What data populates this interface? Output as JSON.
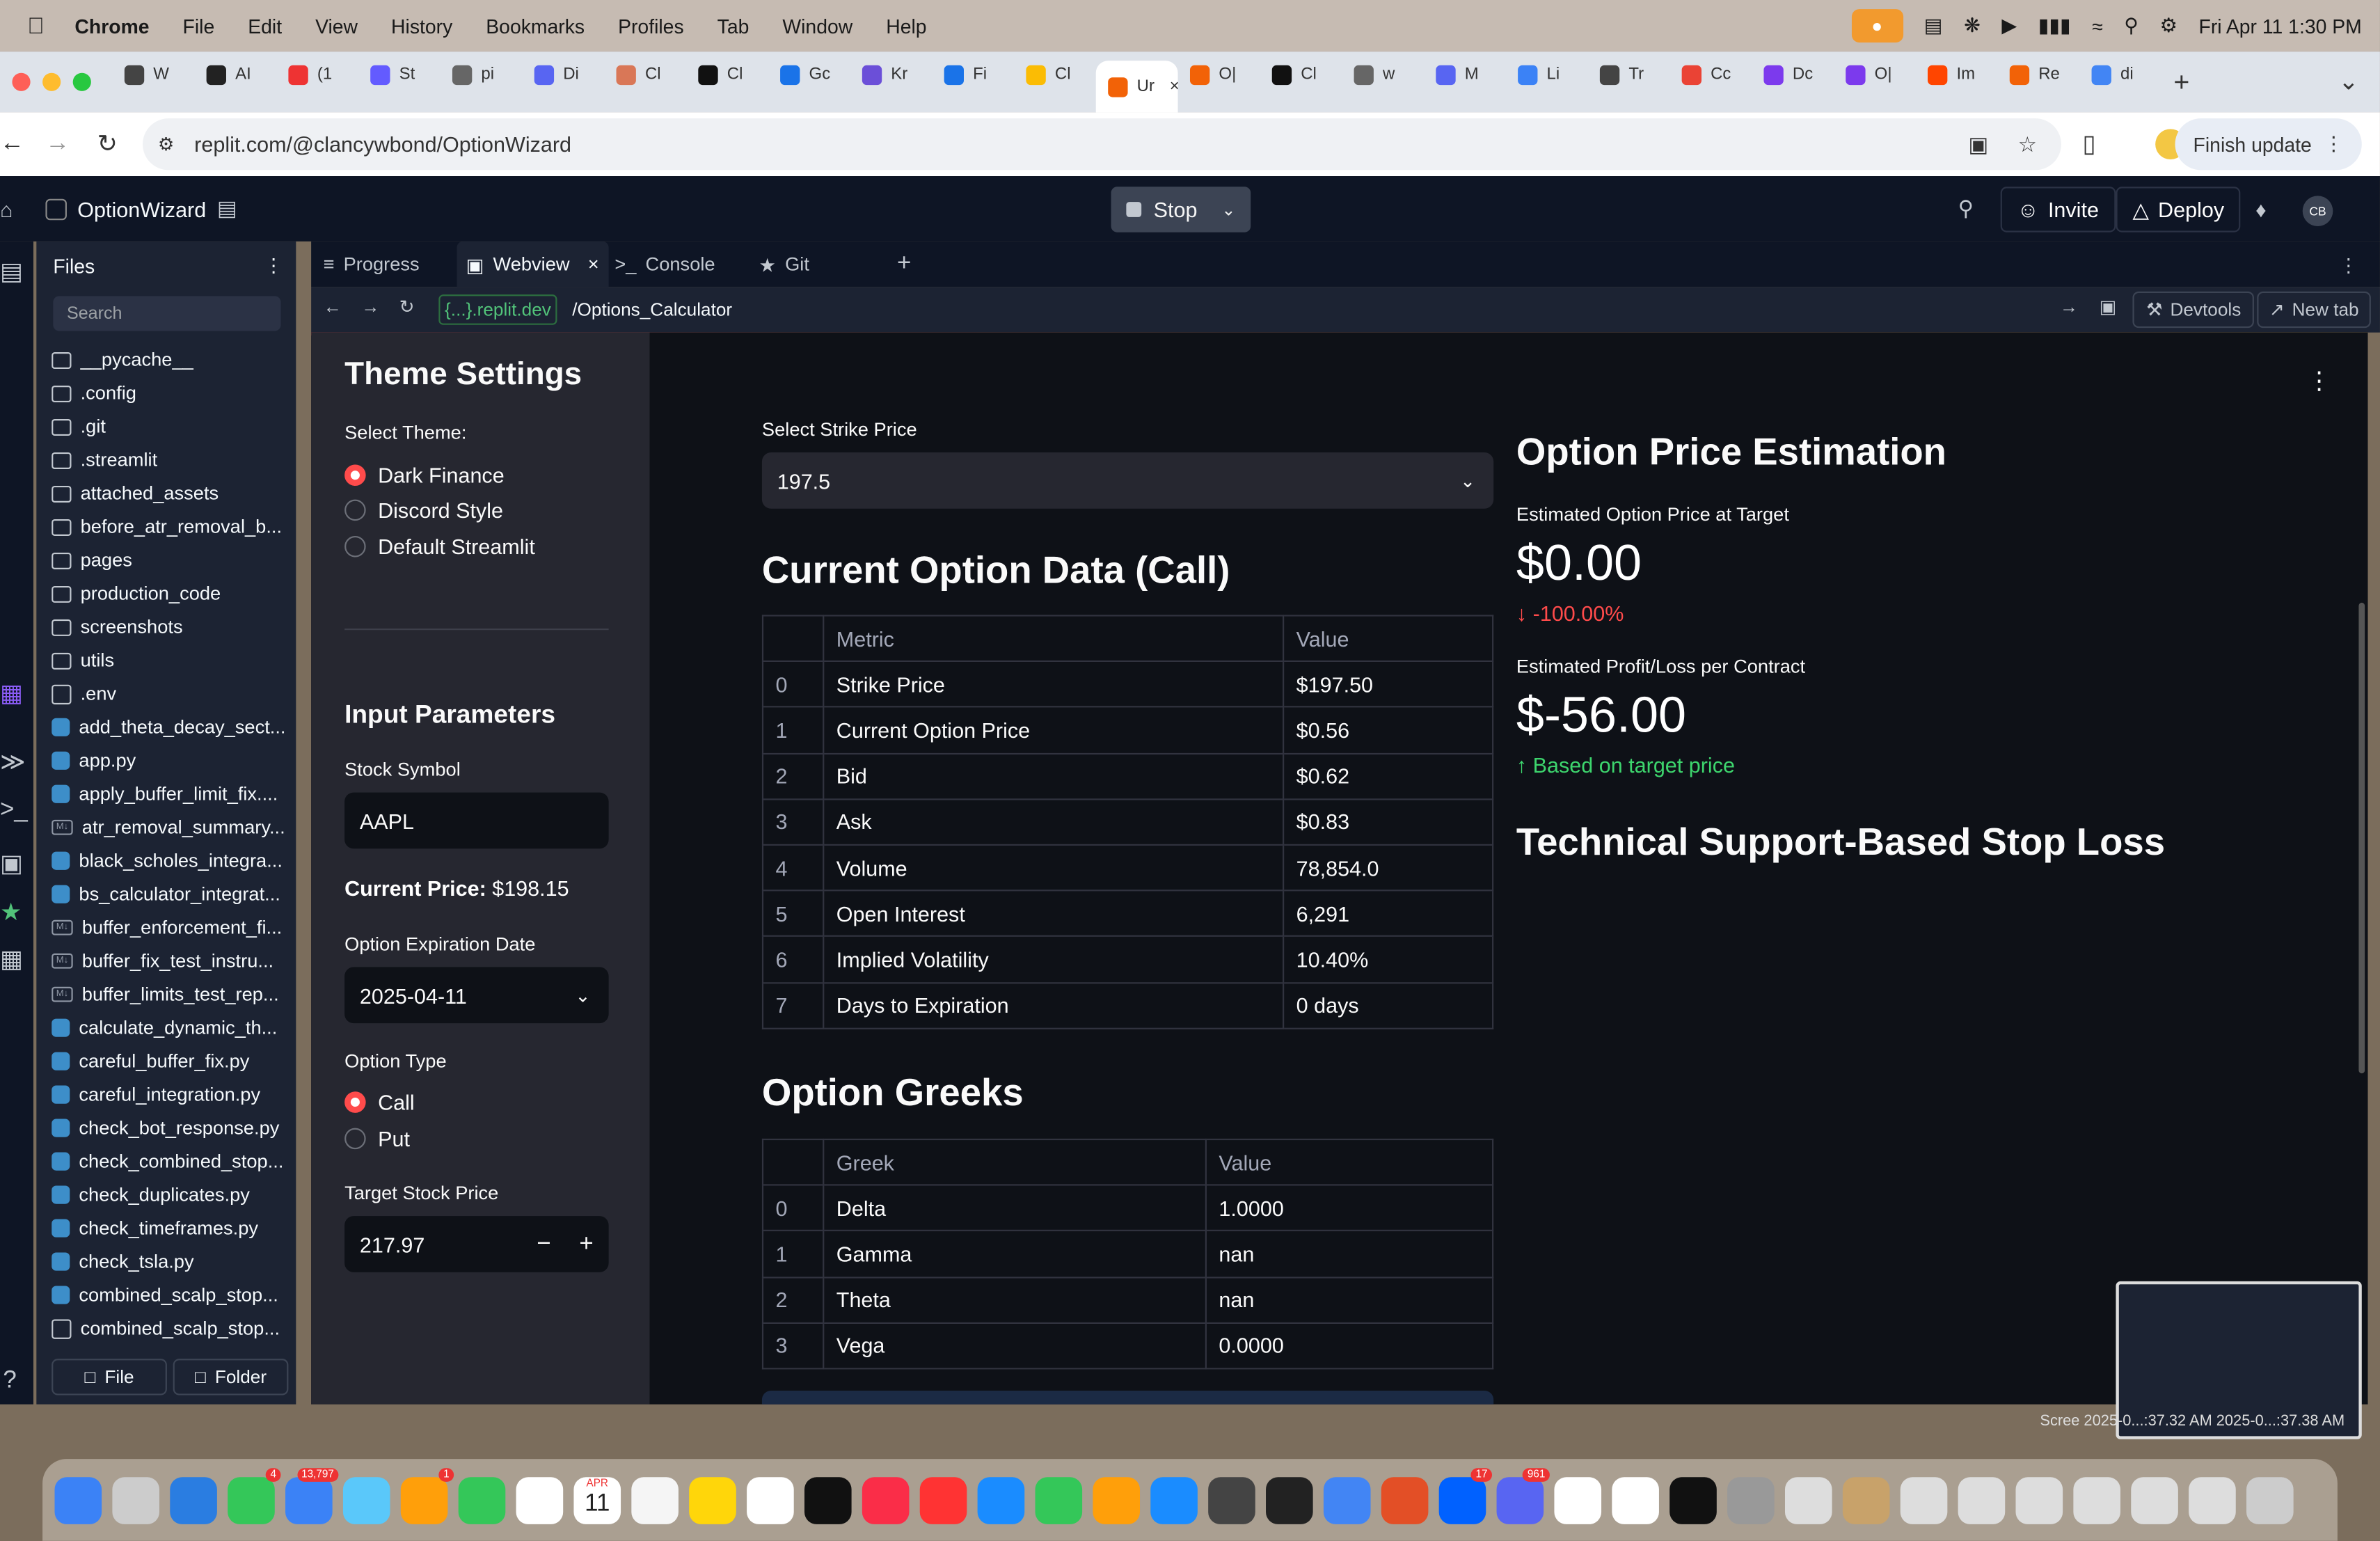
{
  "menubar": {
    "app": "Chrome",
    "items": [
      "File",
      "Edit",
      "View",
      "History",
      "Bookmarks",
      "Profiles",
      "Tab",
      "Window",
      "Help"
    ],
    "datetime": "Fri Apr 11  1:30 PM"
  },
  "chrome_tabs": [
    {
      "label": "W",
      "color": "#444"
    },
    {
      "label": "AI",
      "color": "#222"
    },
    {
      "label": "(1",
      "color": "#e33"
    },
    {
      "label": "St",
      "color": "#635bff"
    },
    {
      "label": "pi",
      "color": "#666"
    },
    {
      "label": "Di",
      "color": "#5865f2"
    },
    {
      "label": "Cl",
      "color": "#d97757"
    },
    {
      "label": "Cl",
      "color": "#111"
    },
    {
      "label": "Gc",
      "color": "#1a73e8"
    },
    {
      "label": "Kr",
      "color": "#6b4fd8"
    },
    {
      "label": "Fi",
      "color": "#1a73e8"
    },
    {
      "label": "Cl",
      "color": "#fbbc04"
    },
    {
      "label": "Ur",
      "color": "#f26207"
    },
    {
      "label": "O|",
      "color": "#f26207"
    },
    {
      "label": "Cl",
      "color": "#111"
    },
    {
      "label": "w",
      "color": "#666"
    },
    {
      "label": "M",
      "color": "#5865f2"
    },
    {
      "label": "Li",
      "color": "#3b82f6"
    },
    {
      "label": "Tr",
      "color": "#444"
    },
    {
      "label": "Cc",
      "color": "#ea4335"
    },
    {
      "label": "Dc",
      "color": "#7c3aed"
    },
    {
      "label": "O|",
      "color": "#7c3aed"
    },
    {
      "label": "Im",
      "color": "#ff4500"
    },
    {
      "label": "Re",
      "color": "#f26207"
    },
    {
      "label": "di",
      "color": "#4285f4"
    }
  ],
  "url": "replit.com/@clancywbond/OptionWizard",
  "finish_update": "Finish update",
  "replit": {
    "project": "OptionWizard",
    "stop": "Stop",
    "invite": "Invite",
    "deploy": "Deploy",
    "avatar": "CB"
  },
  "files": {
    "header": "Files",
    "search": "Search",
    "items": [
      {
        "name": "__pycache__",
        "type": "folder"
      },
      {
        "name": ".config",
        "type": "folder"
      },
      {
        "name": ".git",
        "type": "folder"
      },
      {
        "name": ".streamlit",
        "type": "folder"
      },
      {
        "name": "attached_assets",
        "type": "folder"
      },
      {
        "name": "before_atr_removal_b...",
        "type": "folder"
      },
      {
        "name": "pages",
        "type": "folder"
      },
      {
        "name": "production_code",
        "type": "folder"
      },
      {
        "name": "screenshots",
        "type": "folder"
      },
      {
        "name": "utils",
        "type": "folder"
      },
      {
        "name": ".env",
        "type": "file"
      },
      {
        "name": "add_theta_decay_sect...",
        "type": "py"
      },
      {
        "name": "app.py",
        "type": "py"
      },
      {
        "name": "apply_buffer_limit_fix....",
        "type": "py"
      },
      {
        "name": "atr_removal_summary...",
        "type": "md"
      },
      {
        "name": "black_scholes_integra...",
        "type": "py"
      },
      {
        "name": "bs_calculator_integrat...",
        "type": "py"
      },
      {
        "name": "buffer_enforcement_fi...",
        "type": "md"
      },
      {
        "name": "buffer_fix_test_instru...",
        "type": "md"
      },
      {
        "name": "buffer_limits_test_rep...",
        "type": "md"
      },
      {
        "name": "calculate_dynamic_th...",
        "type": "py"
      },
      {
        "name": "careful_buffer_fix.py",
        "type": "py"
      },
      {
        "name": "careful_integration.py",
        "type": "py"
      },
      {
        "name": "check_bot_response.py",
        "type": "py"
      },
      {
        "name": "check_combined_stop...",
        "type": "py"
      },
      {
        "name": "check_duplicates.py",
        "type": "py"
      },
      {
        "name": "check_timeframes.py",
        "type": "py"
      },
      {
        "name": "check_tsla.py",
        "type": "py"
      },
      {
        "name": "combined_scalp_stop...",
        "type": "py"
      },
      {
        "name": "combined_scalp_stop...",
        "type": "file"
      }
    ],
    "new_file": "File",
    "new_folder": "Folder"
  },
  "webtabs": {
    "progress": "Progress",
    "webview": "Webview",
    "console": "Console",
    "git": "Git"
  },
  "webview": {
    "domain": "{...}.replit.dev",
    "path": "/Options_Calculator",
    "devtools": "Devtools",
    "newtab": "New tab"
  },
  "sidebar": {
    "theme_title": "Theme Settings",
    "select_theme": "Select Theme:",
    "themes": [
      "Dark Finance",
      "Discord Style",
      "Default Streamlit"
    ],
    "input_title": "Input Parameters",
    "stock_symbol_label": "Stock Symbol",
    "stock_symbol": "AAPL",
    "current_price_label": "Current Price:",
    "current_price": "$198.15",
    "expiration_label": "Option Expiration Date",
    "expiration": "2025-04-11",
    "option_type_label": "Option Type",
    "option_types": [
      "Call",
      "Put"
    ],
    "target_label": "Target Stock Price",
    "target": "217.97"
  },
  "main": {
    "strike_label": "Select Strike Price",
    "strike": "197.5",
    "current_title": "Current Option Data (Call)",
    "option_table": {
      "headers": [
        "",
        "Metric",
        "Value"
      ],
      "rows": [
        [
          "0",
          "Strike Price",
          "$197.50"
        ],
        [
          "1",
          "Current Option Price",
          "$0.56"
        ],
        [
          "2",
          "Bid",
          "$0.62"
        ],
        [
          "3",
          "Ask",
          "$0.83"
        ],
        [
          "4",
          "Volume",
          "78,854.0"
        ],
        [
          "5",
          "Open Interest",
          "6,291"
        ],
        [
          "6",
          "Implied Volatility",
          "10.40%"
        ],
        [
          "7",
          "Days to Expiration",
          "0 days"
        ]
      ]
    },
    "greeks_title": "Option Greeks",
    "greeks_table": {
      "headers": [
        "",
        "Greek",
        "Value"
      ],
      "rows": [
        [
          "0",
          "Delta",
          "1.0000"
        ],
        [
          "1",
          "Gamma",
          "nan"
        ],
        [
          "2",
          "Theta",
          "nan"
        ],
        [
          "3",
          "Vega",
          "0.0000"
        ]
      ]
    },
    "estimation_title": "Option Price Estimation",
    "est_price_label": "Estimated Option Price at Target",
    "est_price": "$0.00",
    "est_delta": "-100.00%",
    "pl_label": "Estimated Profit/Loss per Contract",
    "pl_value": "$-56.00",
    "pl_delta": "Based on target price",
    "stoploss_title": "Technical Support-Based Stop Loss"
  },
  "screenshot_label": "Scree 2025-0...:37.32 AM  2025-0...:37.38 AM",
  "dock_badges": {
    "messages": "4",
    "mail": "13,797",
    "photos": "1",
    "calendar_month": "APR",
    "calendar_day": "11",
    "slack": "17",
    "discord": "961"
  }
}
